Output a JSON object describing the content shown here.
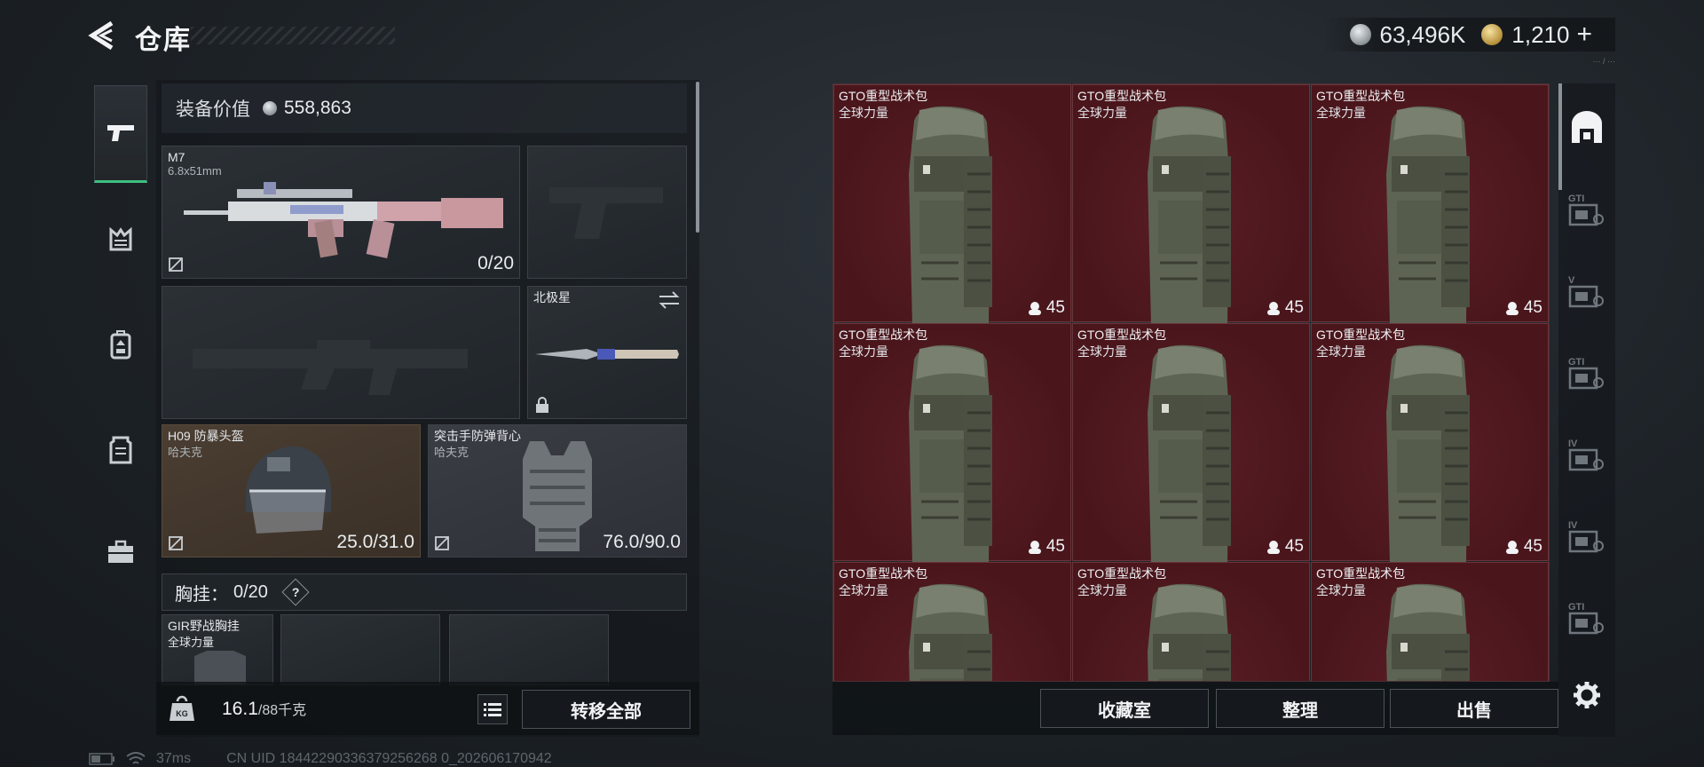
{
  "header": {
    "title": "仓库",
    "currency_silver": "63,496K",
    "currency_gold": "1,210",
    "plus": "+",
    "subtext": "··· / ···"
  },
  "equipment": {
    "value_label": "装备价值",
    "value": "558,863",
    "primary_weapon": {
      "name": "M7",
      "caliber": "6.8x51mm",
      "ammo": "0/20"
    },
    "melee": {
      "name": "北极星"
    },
    "helmet": {
      "name": "H09 防暴头盔",
      "brand": "哈夫克",
      "durability": "25.0/31.0"
    },
    "armor": {
      "name": "突击手防弹背心",
      "brand": "哈夫克",
      "durability": "76.0/90.0"
    },
    "rig": {
      "label": "胸挂：",
      "capacity": "0/20",
      "help": "?",
      "item_name": "GIR野战胸挂",
      "item_brand": "全球力量"
    }
  },
  "bottom": {
    "weight": "16.1",
    "weight_max": "/88千克",
    "transfer_all": "转移全部"
  },
  "grid_actions": {
    "collection": "收藏室",
    "sort": "整理",
    "sell": "出售"
  },
  "stash_items": [
    {
      "name": "GTO重型战术包",
      "brand": "全球力量",
      "count": "45"
    },
    {
      "name": "GTO重型战术包",
      "brand": "全球力量",
      "count": "45"
    },
    {
      "name": "GTO重型战术包",
      "brand": "全球力量",
      "count": "45"
    },
    {
      "name": "GTO重型战术包",
      "brand": "全球力量",
      "count": "45"
    },
    {
      "name": "GTO重型战术包",
      "brand": "全球力量",
      "count": "45"
    },
    {
      "name": "GTO重型战术包",
      "brand": "全球力量",
      "count": "45"
    },
    {
      "name": "GTO重型战术包",
      "brand": "全球力量",
      "count": ""
    },
    {
      "name": "GTO重型战术包",
      "brand": "全球力量",
      "count": ""
    },
    {
      "name": "GTO重型战术包",
      "brand": "全球力量",
      "count": ""
    }
  ],
  "status": {
    "ping": "37ms",
    "uid": "CN UID 18442290336379256268 0_202606170942"
  },
  "right_nav_labels": [
    "GTI",
    "V",
    "GTI",
    "IV",
    "IV",
    "GTI"
  ],
  "colors": {
    "accent_green": "#3fbf7f",
    "cell_red": "#4a161c",
    "brown_slot": "#4b3e32"
  }
}
